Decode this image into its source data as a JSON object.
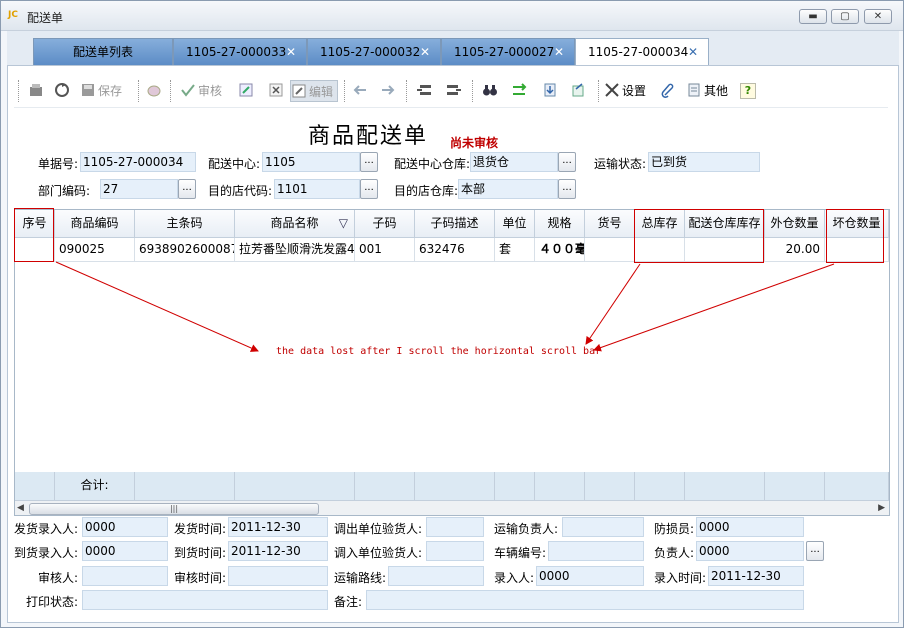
{
  "window": {
    "title": "配送单",
    "logo": "JC",
    "min": "▬",
    "max": "▢",
    "close": "✕"
  },
  "tabs": [
    {
      "label": "配送单列表",
      "closable": false
    },
    {
      "label": "1105-27-000033",
      "closable": true
    },
    {
      "label": "1105-27-000032",
      "closable": true
    },
    {
      "label": "1105-27-000027",
      "closable": true
    },
    {
      "label": "1105-27-000034",
      "closable": true,
      "active": true
    }
  ],
  "tab_close_glyph": "✕",
  "toolbar": {
    "save": "保存",
    "audit": "审核",
    "edit": "编辑",
    "settings": "设置",
    "other": "其他",
    "help": "?"
  },
  "doc": {
    "title": "商品配送单",
    "status": "尚未审核"
  },
  "header": {
    "doc_no_label": "单据号:",
    "doc_no": "1105-27-000034",
    "center_label": "配送中心:",
    "center": "1105",
    "center_wh_label": "配送中心仓库:",
    "center_wh": "退货仓",
    "transport_label": "运输状态:",
    "transport": "已到货",
    "dept_label": "部门编码:",
    "dept": "27",
    "dest_label": "目的店代码:",
    "dest": "1101",
    "dest_wh_label": "目的店仓库:",
    "dest_wh": "本部",
    "dots": "..."
  },
  "grid": {
    "columns": [
      "序号",
      "商品编码",
      "主条码",
      "商品名称",
      "子码",
      "子码描述",
      "单位",
      "规格",
      "货号",
      "总库存",
      "配送仓库库存",
      "外仓数量",
      "坏仓数量"
    ],
    "filter_glyph": "▽",
    "row": [
      "",
      "090025",
      "6938902600087",
      "拉芳番坠顺滑洗发露4",
      "001",
      "632476",
      "套",
      "４００毫",
      "",
      "",
      "",
      "20.00",
      ""
    ],
    "footer_label": "合计:",
    "scroll_left": "◀",
    "scroll_right": "▶",
    "scroll_thumb": "|||"
  },
  "annotation": "the data lost after I scroll the horizontal scroll bar",
  "bottom": {
    "r1": [
      {
        "label": "发货录入人:",
        "value": "0000"
      },
      {
        "label": "发货时间:",
        "value": "2011-12-30"
      },
      {
        "label": "调出单位验货人:",
        "value": ""
      },
      {
        "label": "运输负责人:",
        "value": ""
      },
      {
        "label": "防损员:",
        "value": "0000"
      }
    ],
    "r2": [
      {
        "label": "到货录入人:",
        "value": "0000"
      },
      {
        "label": "到货时间:",
        "value": "2011-12-30"
      },
      {
        "label": "调入单位验货人:",
        "value": ""
      },
      {
        "label": "车辆编号:",
        "value": ""
      },
      {
        "label": "负责人:",
        "value": "0000"
      }
    ],
    "r3": [
      {
        "label": "审核人:",
        "value": ""
      },
      {
        "label": "审核时间:",
        "value": ""
      },
      {
        "label": "运输路线:",
        "value": ""
      },
      {
        "label": "录入人:",
        "value": "0000"
      },
      {
        "label": "录入时间:",
        "value": "2011-12-30"
      }
    ],
    "r4": [
      {
        "label": "打印状态:",
        "value": ""
      },
      {
        "label": "备注:",
        "value": ""
      }
    ]
  },
  "colors": {
    "annotation": "#c00000",
    "tab_bg": "#6d9bd1",
    "field_bg": "#e6f0fa"
  }
}
